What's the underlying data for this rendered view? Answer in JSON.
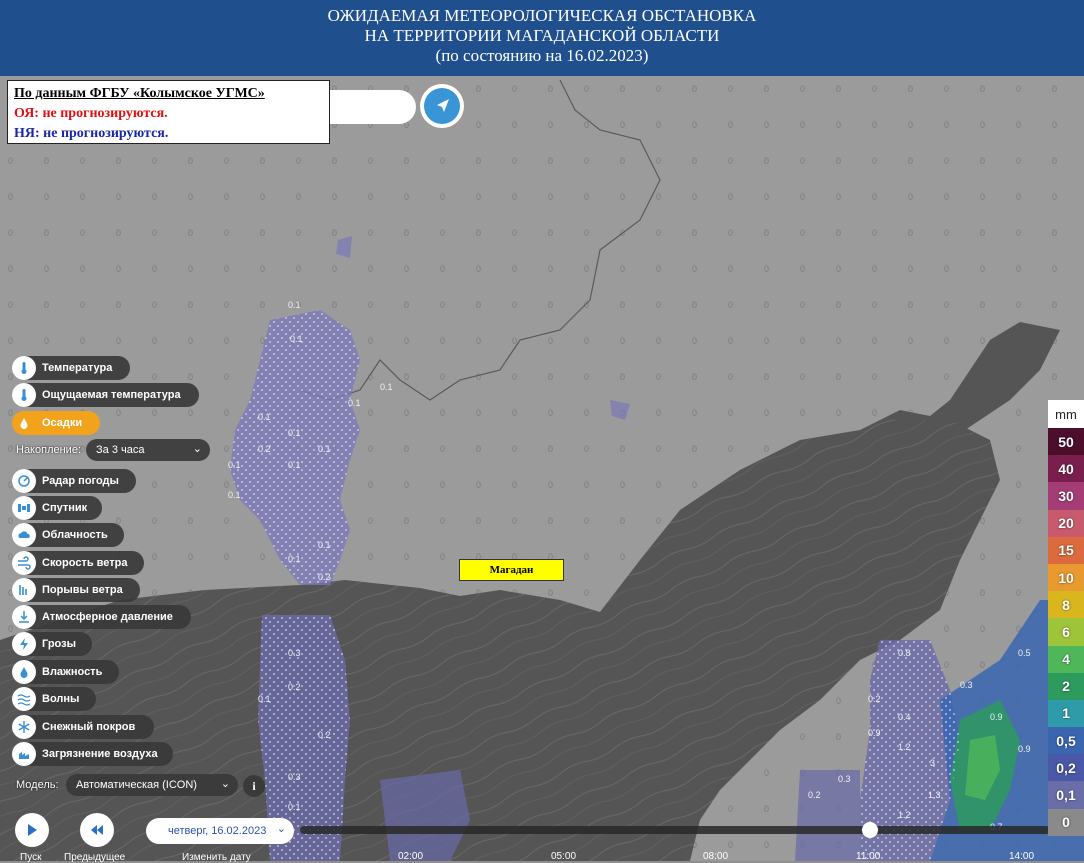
{
  "header": {
    "line1": "ОЖИДАЕМАЯ МЕТЕОРОЛОГИЧЕСКАЯ  ОБСТАНОВКА",
    "line2": "НА  ТЕРРИТОРИИ МАГАДАНСКОЙ  ОБЛАСТИ",
    "line3": "(по состоянию на 16.02.2023)"
  },
  "infobox": {
    "source": "По данным ФГБУ «Колымское УГМС»",
    "oya": "ОЯ:  не прогнозируются.",
    "nya": "НЯ:  не прогнозируются."
  },
  "city_label": "Магадан",
  "menu": [
    {
      "label": "Температура",
      "icon": "thermometer-icon",
      "active": false
    },
    {
      "label": "Ощущаемая температура",
      "icon": "feels-like-icon",
      "active": false
    },
    {
      "label": "Осадки",
      "icon": "droplet-icon",
      "active": true
    },
    {
      "label": "Радар погоды",
      "icon": "radar-icon",
      "active": false
    },
    {
      "label": "Спутник",
      "icon": "satellite-icon",
      "active": false
    },
    {
      "label": "Облачность",
      "icon": "cloud-icon",
      "active": false
    },
    {
      "label": "Скорость ветра",
      "icon": "wind-icon",
      "active": false
    },
    {
      "label": "Порывы ветра",
      "icon": "gust-icon",
      "active": false
    },
    {
      "label": "Атмосферное давление",
      "icon": "pressure-icon",
      "active": false
    },
    {
      "label": "Грозы",
      "icon": "lightning-icon",
      "active": false
    },
    {
      "label": "Влажность",
      "icon": "humidity-icon",
      "active": false
    },
    {
      "label": "Волны",
      "icon": "waves-icon",
      "active": false
    },
    {
      "label": "Снежный покров",
      "icon": "snowflake-icon",
      "active": false
    },
    {
      "label": "Загрязнение воздуха",
      "icon": "pollution-icon",
      "active": false
    }
  ],
  "accumulation": {
    "label": "Накопление:",
    "value": "За 3 часа"
  },
  "model": {
    "label": "Модель:",
    "value": "Автоматическая (ICON)"
  },
  "controls": {
    "play_label": "Пуск",
    "prev_label": "Предыдущее",
    "date_value": "четверг, 16.02.2023",
    "change_date_label": "Изменить дату"
  },
  "timeline": {
    "ticks": [
      "02:00",
      "05:00",
      "08:00",
      "11:00",
      "14:00"
    ],
    "position": 0.76
  },
  "legend": {
    "unit": "mm",
    "items": [
      {
        "label": "50",
        "color": "#4b0f2b"
      },
      {
        "label": "40",
        "color": "#7a1f4d"
      },
      {
        "label": "30",
        "color": "#a43c76"
      },
      {
        "label": "20",
        "color": "#c85a6e"
      },
      {
        "label": "15",
        "color": "#db6b3e"
      },
      {
        "label": "10",
        "color": "#e89a2e"
      },
      {
        "label": "8",
        "color": "#d9b51e"
      },
      {
        "label": "6",
        "color": "#9ec43a"
      },
      {
        "label": "4",
        "color": "#4fb65a"
      },
      {
        "label": "2",
        "color": "#2d9a5e"
      },
      {
        "label": "1",
        "color": "#2f9aa8"
      },
      {
        "label": "0,5",
        "color": "#3a66b0"
      },
      {
        "label": "0,2",
        "color": "#4a58a8"
      },
      {
        "label": "0,1",
        "color": "#6a6ea8"
      },
      {
        "label": "0",
        "color": "#8a8a8a"
      }
    ]
  },
  "colors": {
    "header_bg": "#1f4f8c",
    "land": "#9b9b9b",
    "sea": "#555555",
    "precip_light": "#7a78b8",
    "precip_green": "#3aa55a"
  }
}
